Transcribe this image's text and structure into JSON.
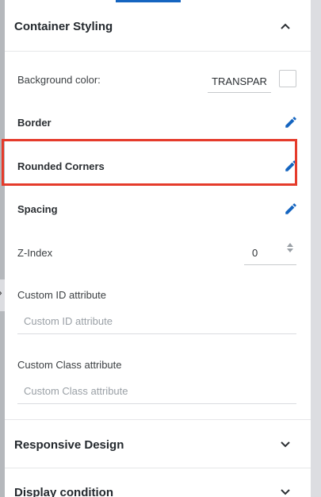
{
  "container_styling": {
    "title": "Container Styling",
    "background_color_label": "Background color:",
    "background_color_value": "TRANSPAR",
    "border_label": "Border",
    "rounded_corners_label": "Rounded Corners",
    "spacing_label": "Spacing",
    "zindex_label": "Z-Index",
    "zindex_value": "0",
    "custom_id_label": "Custom ID attribute",
    "custom_id_placeholder": "Custom ID attribute",
    "custom_class_label": "Custom Class attribute",
    "custom_class_placeholder": "Custom Class attribute"
  },
  "responsive_design": {
    "title": "Responsive Design"
  },
  "display_condition": {
    "title": "Display condition"
  },
  "colors": {
    "accent": "#1565c0",
    "highlight": "#e53b2b"
  },
  "icons": {
    "collapse": "chevron-up-icon",
    "expand": "chevron-down-icon",
    "edit": "pencil-icon"
  }
}
